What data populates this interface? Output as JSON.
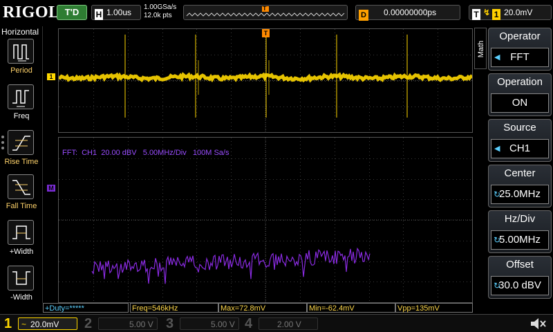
{
  "header": {
    "brand": "RIGOL",
    "run_state": "T'D",
    "timebase_key": "H",
    "timebase_value": "1.00us",
    "sample_rate": "1.00GSa/s",
    "mem_depth": "12.0k pts",
    "trigger_pos_marker": "T",
    "delay_key": "D",
    "delay_value": "0.00000000ps",
    "trigger_key": "T",
    "trigger_channel": "1",
    "trigger_level": "20.0mV"
  },
  "left_panel": {
    "title": "Horizontal",
    "items": [
      {
        "label": "Period"
      },
      {
        "label": "Freq"
      },
      {
        "label": "Rise Time"
      },
      {
        "label": "Fall Time"
      },
      {
        "label": "+Width"
      },
      {
        "label": "-Width"
      }
    ]
  },
  "screen": {
    "ch1_marker": "1",
    "math_marker": "M",
    "trigger_marker": "T",
    "fft_label": "FFT:  CH1  20.00 dBV   5.00MHz/Div   100M Sa/s"
  },
  "measurements": [
    {
      "text": "+Duty=*****"
    },
    {
      "text": "Freq=546kHz"
    },
    {
      "text": "Max=72.8mV"
    },
    {
      "text": "Min=-62.4mV"
    },
    {
      "text": "Vpp=135mV"
    }
  ],
  "right_panel": {
    "tab": "Math",
    "menu": [
      {
        "title": "Operator",
        "value": "FFT"
      },
      {
        "title": "Operation",
        "value": "ON"
      },
      {
        "title": "Source",
        "value": "CH1"
      },
      {
        "title": "Center",
        "value": "25.0MHz"
      },
      {
        "title": "Hz/Div",
        "value": "5.00MHz"
      },
      {
        "title": "Offset",
        "value": "30.0 dBV"
      }
    ]
  },
  "channels": [
    {
      "num": "1",
      "coupling": "~",
      "scale": "20.0mV",
      "color": "#ffd800",
      "active": true
    },
    {
      "num": "2",
      "coupling": "",
      "scale": "5.00 V",
      "color": "#27c7e6",
      "active": false
    },
    {
      "num": "3",
      "coupling": "",
      "scale": "5.00 V",
      "color": "#d23cc8",
      "active": false
    },
    {
      "num": "4",
      "coupling": "",
      "scale": "2.00 V",
      "color": "#2f6fe0",
      "active": false
    }
  ],
  "colors": {
    "ch1": "#ffd800",
    "math": "#8a2be2",
    "trigger": "#ff8a00",
    "accent": "#5bd0ff"
  }
}
